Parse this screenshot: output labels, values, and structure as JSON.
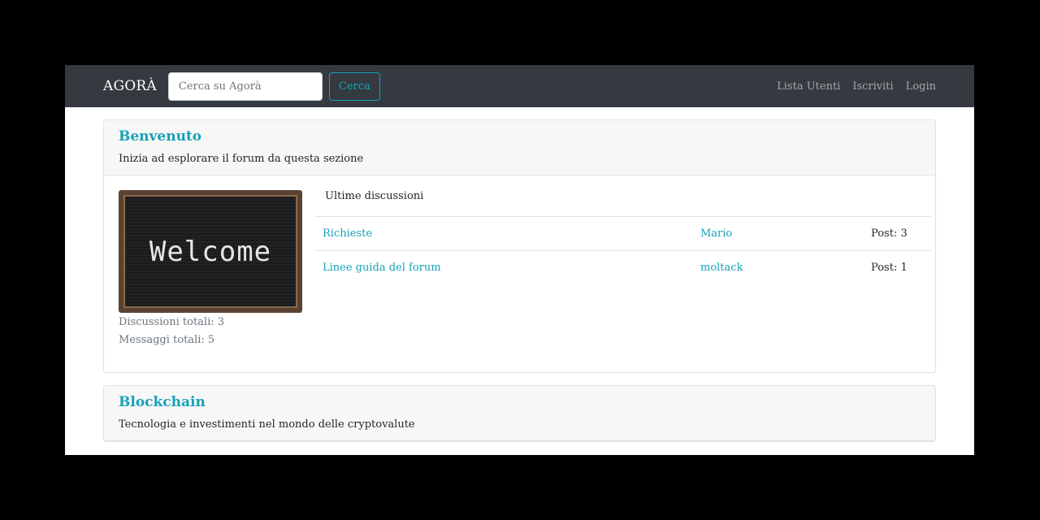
{
  "navbar": {
    "brand": "AGORÀ",
    "search_placeholder": "Cerca su Agorà",
    "search_button": "Cerca",
    "links": [
      "Lista Utenti",
      "Iscriviti",
      "Login"
    ]
  },
  "sections": [
    {
      "title": "Benvenuto",
      "description": "Inizia ad esplorare il forum da questa sezione",
      "image_text": "Welcome",
      "stats": {
        "discussions": "Discussioni totali: 3",
        "messages": "Messaggi totali: 5"
      },
      "table_header": "Ultime discussioni",
      "rows": [
        {
          "topic": "Richieste",
          "author": "Mario",
          "posts": "Post: 3"
        },
        {
          "topic": "Linee guida del forum",
          "author": "moltack",
          "posts": "Post: 1"
        }
      ]
    },
    {
      "title": "Blockchain",
      "description": "Tecnologia e investimenti nel mondo delle cryptovalute"
    }
  ],
  "colors": {
    "navbar_bg": "#343a40",
    "accent": "#17a2b8"
  }
}
